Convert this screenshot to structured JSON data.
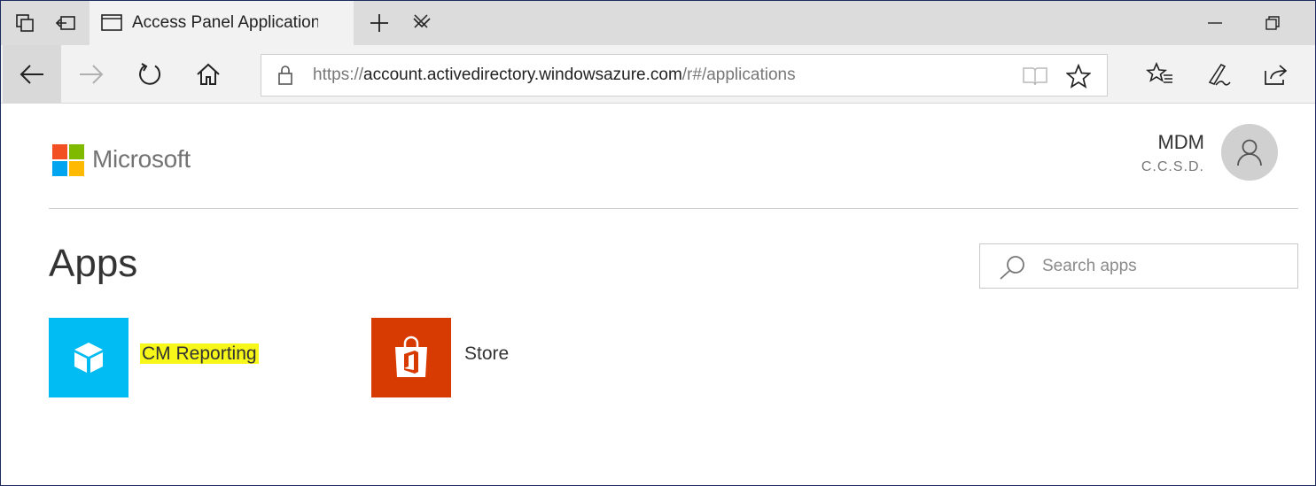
{
  "browser": {
    "tab_title": "Access Panel Application",
    "url_scheme": "https://",
    "url_host": "account.activedirectory.windowsazure.com",
    "url_path": "/r#/applications"
  },
  "header": {
    "brand": "Microsoft",
    "user_name": "MDM",
    "user_org": "C.C.S.D."
  },
  "main": {
    "title": "Apps",
    "search_placeholder": "Search apps",
    "apps": [
      {
        "label": "CM Reporting",
        "icon": "cube-icon",
        "color": "#00bcf2"
      },
      {
        "label": "Store",
        "icon": "office-bag-icon",
        "color": "#d83b01"
      }
    ]
  },
  "colors": {
    "ms_red": "#f25022",
    "ms_green": "#7fba00",
    "ms_blue": "#00a4ef",
    "ms_yellow": "#ffb900",
    "highlight": "#f7f71a"
  }
}
